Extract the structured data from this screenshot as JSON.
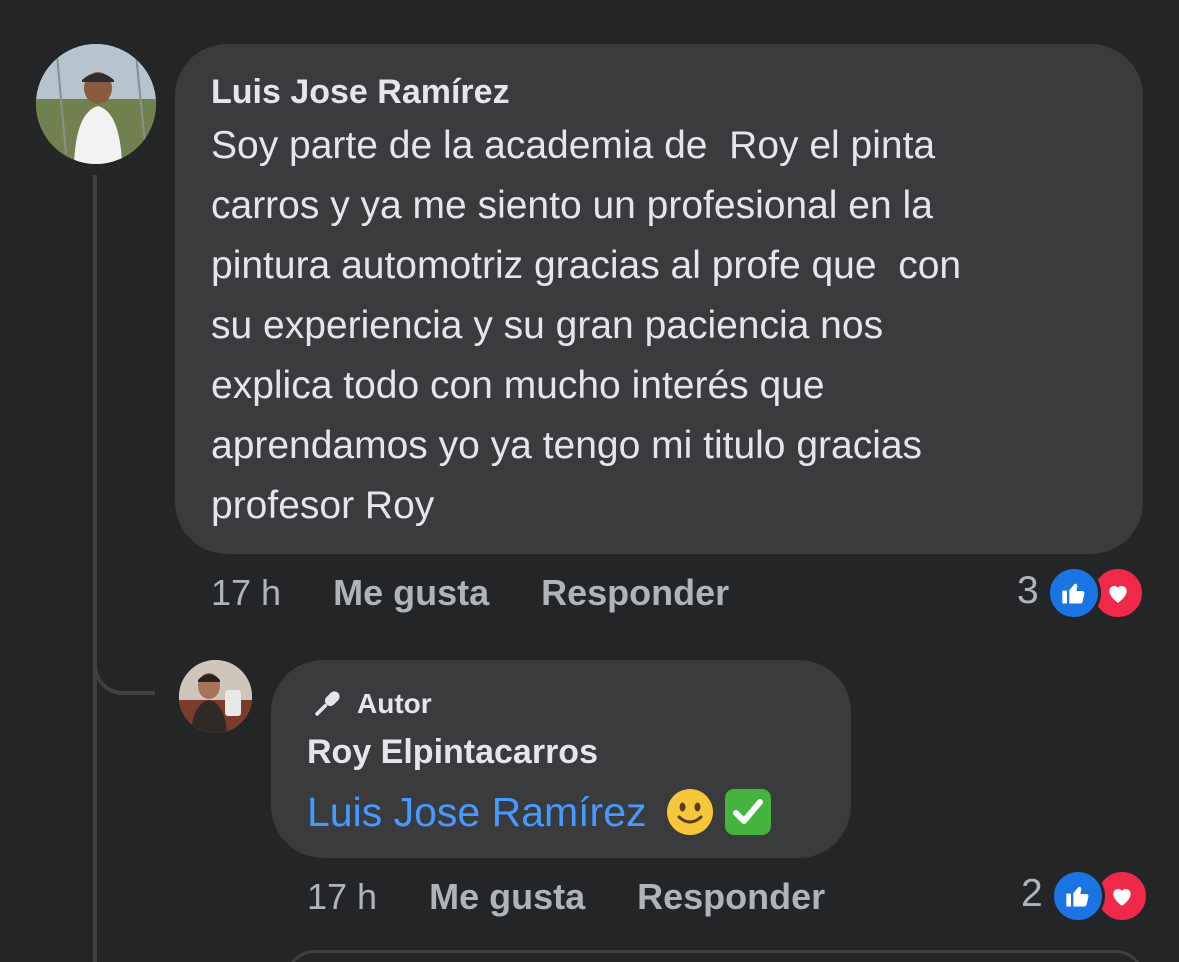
{
  "comment": {
    "author": "Luis Jose Ramírez",
    "lines": [
      "Soy parte de la academia de  Roy el pinta",
      "carros y ya me siento un profesional en la",
      "pintura automotriz gracias al profe que  con",
      "su experiencia y su gran paciencia nos",
      "explica todo con mucho interés que",
      "aprendamos yo ya tengo mi titulo gracias",
      "profesor Roy"
    ],
    "time": "17 h",
    "like_label": "Me gusta",
    "reply_label": "Responder",
    "reaction_count": "3",
    "reactions": [
      "like-icon",
      "love-icon"
    ]
  },
  "reply": {
    "badge": "Autor",
    "badge_icon": "microphone-icon",
    "author": "Roy Elpintacarros",
    "mention": "Luis Jose Ramírez",
    "emojis": [
      "smiling-face-icon",
      "check-mark-button-icon"
    ],
    "time": "17 h",
    "like_label": "Me gusta",
    "reply_label": "Responder",
    "reaction_count": "2",
    "reactions": [
      "like-icon",
      "love-icon"
    ]
  },
  "colors": {
    "background": "#242526",
    "bubble": "#3a3b3c",
    "primary_text": "#e4e6eb",
    "secondary_text": "#b0b3b8",
    "mention": "#4599ff",
    "like": "#1b74e4",
    "love": "#f0284a"
  }
}
